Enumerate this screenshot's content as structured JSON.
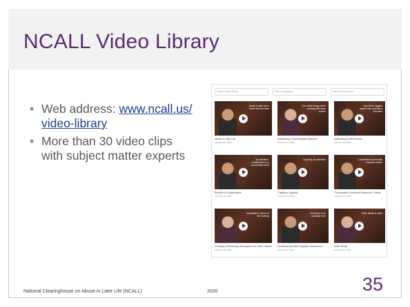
{
  "slide": {
    "title": "NCALL Video Library",
    "bullets": {
      "web_label": "Web address:",
      "web_link": "www.ncall.us/video-library",
      "clips_text": "More than 30 video clips with subject matter experts"
    },
    "footer_org": "National Clearinghouse on Abuse in Later Life (NCALL)",
    "footer_year": "2020",
    "page_number": "35"
  },
  "colors": {
    "title": "#5b2c6f",
    "body_text": "#595959",
    "link": "#1f3f8f"
  },
  "screenshot": {
    "search_placeholder": "Search video library",
    "filter_label": "Filter by category",
    "sort_label": "Sort by newest first",
    "videos": [
      {
        "title": "Abuse in Later Life",
        "date": "February 12, 2020",
        "quote": "Abuse in later life is more than we think",
        "figure": "man"
      },
      {
        "title": "Addressing Communication Barriers",
        "date": "February 12, 2020",
        "quote": "One of the things we're working with older victims",
        "figure": "woman"
      },
      {
        "title": "Addressing Frail/Ill Abuse",
        "date": "February 12, 2020",
        "quote": "One of the biggest issues with working in this area",
        "figure": "man"
      },
      {
        "title": "Benefits of Collaboration",
        "date": "February 12, 2020",
        "quote": "By definition, collaboration is a coordinated effort",
        "figure": "man"
      },
      {
        "title": "Cognitive Capacity",
        "date": "February 12, 2020",
        "quote": "Capacity, by definition",
        "figure": "man"
      },
      {
        "title": "Coordinated Community Response Teams",
        "date": "February 12, 2020",
        "quote": "Coordinated community response teams",
        "figure": "man"
      },
      {
        "title": "Creating a Welcoming Atmosphere for Older Victims",
        "date": "February 12, 2020",
        "quote": "Accessible in terms of the building",
        "figure": "woman"
      },
      {
        "title": "Dementia and Mild Cognitive Impairment",
        "date": "February 12, 2020",
        "quote": "Dementia is an umbrella term",
        "figure": "man"
      },
      {
        "title": "Elder Abuse",
        "date": "February 12, 2020",
        "quote": "Elder abuse is often",
        "figure": "woman"
      }
    ]
  }
}
